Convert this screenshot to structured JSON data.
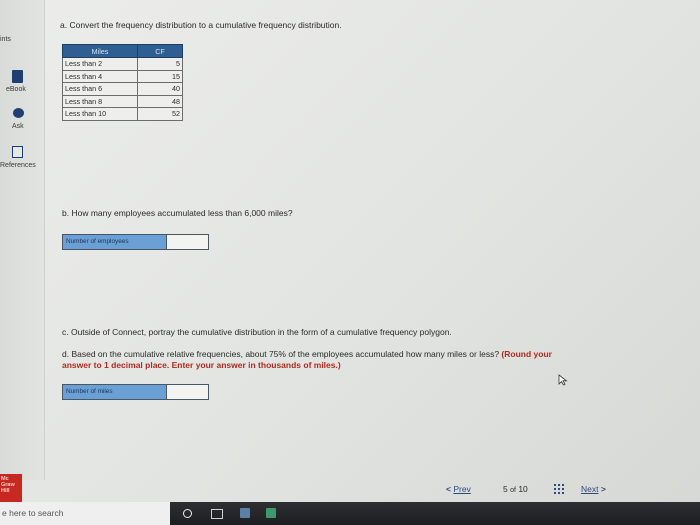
{
  "sidebar": {
    "points": "ints",
    "ebook": "eBook",
    "ask": "Ask",
    "references": "References"
  },
  "part_a": {
    "prompt": "a. Convert the frequency distribution to a cumulative frequency distribution.",
    "table": {
      "headers": [
        "Miles",
        "CF"
      ],
      "rows": [
        {
          "label": "Less than 2",
          "cf": "5"
        },
        {
          "label": "Less than 4",
          "cf": "15"
        },
        {
          "label": "Less than 6",
          "cf": "40"
        },
        {
          "label": "Less than 8",
          "cf": "48"
        },
        {
          "label": "Less than 10",
          "cf": "52"
        }
      ]
    }
  },
  "part_b": {
    "prompt": "b. How many employees accumulated less than 6,000 miles?",
    "field_label": "Number of employees"
  },
  "part_c": {
    "prompt": "c. Outside of Connect, portray the cumulative distribution in the form of a cumulative frequency polygon."
  },
  "part_d": {
    "prompt": "d. Based on the cumulative relative frequencies, about 75% of the employees accumulated how many miles or less?",
    "instruction_1": "(Round your",
    "instruction_2": "answer to 1 decimal place. Enter your answer in thousands of miles.)",
    "field_label": "Number of miles"
  },
  "nav": {
    "prev": "Prev",
    "current": "5",
    "of": "of",
    "total": "10",
    "next": "Next"
  },
  "logo": {
    "line1": "Mc",
    "line2": "Graw",
    "line3": "Hill"
  },
  "taskbar": {
    "search_placeholder": "e here to search"
  },
  "colors": {
    "table_header": "#2f5f92",
    "field_label_bg": "#6aa0d6",
    "instruction_red": "#b02a1e",
    "nav_link": "#2e4a77",
    "logo_red": "#c8281f"
  }
}
